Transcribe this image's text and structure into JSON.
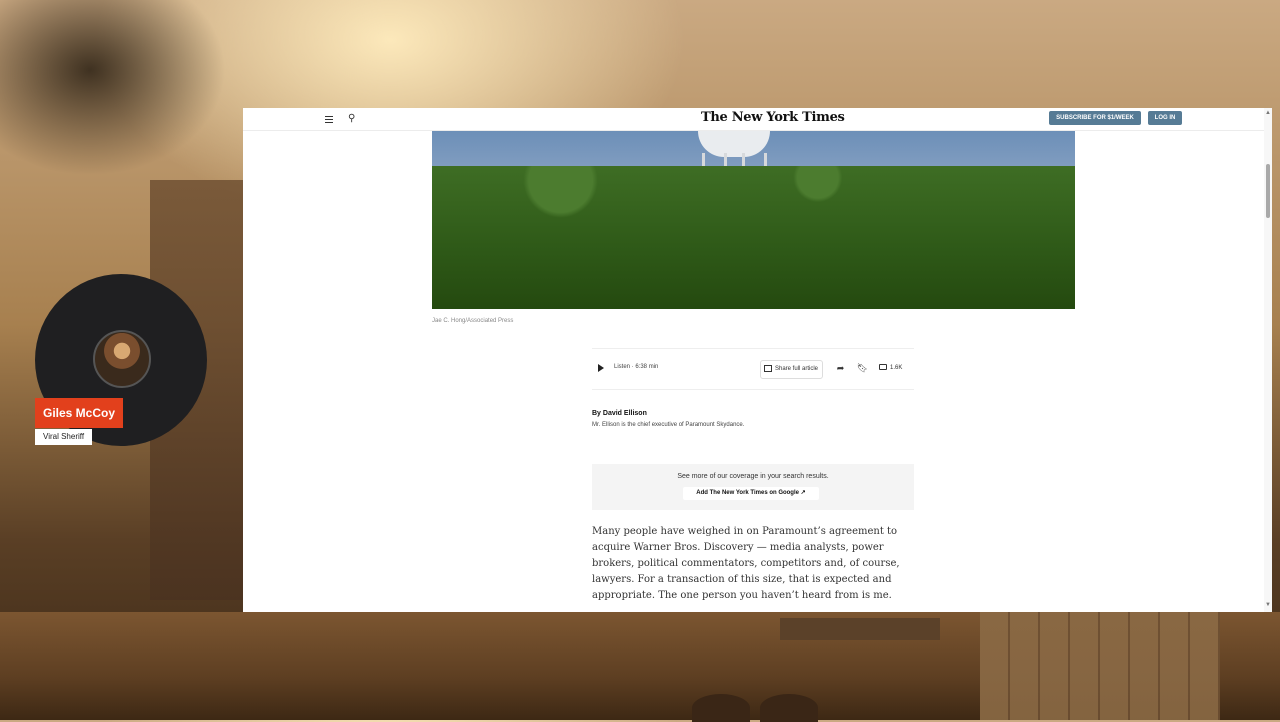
{
  "overlay": {
    "name": "Giles McCoy",
    "subtitle": "Viral Sheriff"
  },
  "header": {
    "logo": "The New York Times",
    "subscribe_label": "SUBSCRIBE FOR $1/WEEK",
    "login_label": "LOG IN",
    "menu_icon": "hamburger-menu-icon",
    "search_icon": "search-icon"
  },
  "article": {
    "photo_credit": "Jae C. Hong/Associated Press",
    "listen_label": "Listen · 6:38 min",
    "share_full_label": "Share full article",
    "comments_count": "1.6K",
    "byline": "By David Ellison",
    "byline_desc": "Mr. Ellison is the chief executive of Paramount Skydance.",
    "google_prompt": "See more of our coverage in your search results.",
    "google_button": "Add The New York Times on Google ↗",
    "body_paragraph": "Many people have weighed in on Paramount’s agreement to acquire Warner Bros. Discovery — media analysts, power brokers, political commentators, competitors and, of course, lawyers. For a transaction of this size, that is expected and appropriate. The one person you haven’t heard from is me."
  },
  "colors": {
    "name_tag_bg": "#e2401c",
    "header_button_bg": "#567b95"
  }
}
